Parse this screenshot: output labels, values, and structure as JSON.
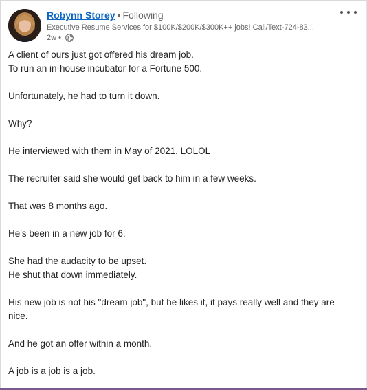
{
  "post": {
    "author_name": "Robynn Storey",
    "follow_status": "Following",
    "headline": "Executive Resume Services for $100K/$200K/$300K++ jobs! Call/Text-724-83...",
    "age": "2w",
    "visibility_icon": "globe-icon",
    "more_icon": "more-options-icon",
    "paragraphs": [
      [
        "A client of ours just got offered his dream job.",
        "To run an in-house incubator for a Fortune 500."
      ],
      [
        "Unfortunately, he had to turn it down."
      ],
      [
        "Why?"
      ],
      [
        "He interviewed with them in May of 2021. LOLOL"
      ],
      [
        "The recruiter said she would get back to him in a few weeks."
      ],
      [
        "That was 8 months ago."
      ],
      [
        "He's been in a new job for 6."
      ],
      [
        "She had the audacity to be upset.",
        "He shut that down immediately."
      ],
      [
        "His new job is not his \"dream job\", but he likes it, it pays really well and they are nice."
      ],
      [
        "And he got an offer within a month."
      ],
      [
        "A job is a job is a job."
      ]
    ]
  }
}
